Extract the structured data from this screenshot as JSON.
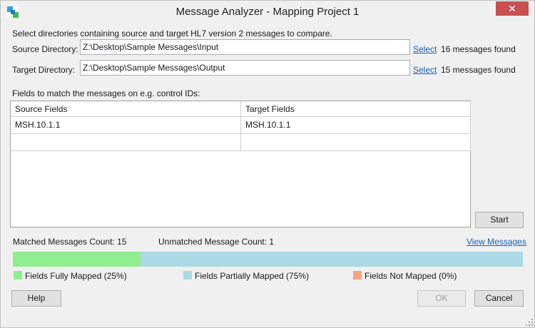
{
  "window": {
    "title": "Message Analyzer - Mapping Project 1",
    "close_label": "✕"
  },
  "intro": "Select directories containing source and target HL7 version 2 messages to compare.",
  "source": {
    "label": "Source Directory:",
    "value": "Z:\\Desktop\\Sample Messages\\Input",
    "select_label": "Select",
    "found_text": "16 messages found"
  },
  "target": {
    "label": "Target Directory:",
    "value": "Z:\\Desktop\\Sample Messages\\Output",
    "select_label": "Select",
    "found_text": "15 messages found"
  },
  "fields_caption": "Fields to match the messages on e.g. control IDs:",
  "grid": {
    "headers": [
      "Source Fields",
      "Target Fields"
    ],
    "rows": [
      [
        "MSH.10.1.1",
        "MSH.10.1.1"
      ],
      [
        "",
        ""
      ]
    ]
  },
  "start_label": "Start",
  "stats": {
    "matched": "Matched Messages Count: 15",
    "unmatched": "Unmatched Message Count: 1",
    "view_messages": "View Messages"
  },
  "progress": {
    "fully_mapped_fraction": 0.25,
    "fully_color": "#90ee90",
    "partial_color": "#add8e6",
    "not_color": "#f4a582"
  },
  "legend": {
    "fully": "Fields Fully Mapped (25%)",
    "partial": "Fields Partially Mapped (75%)",
    "not": "Fields Not Mapped (0%)"
  },
  "buttons": {
    "help": "Help",
    "ok": "OK",
    "cancel": "Cancel"
  }
}
